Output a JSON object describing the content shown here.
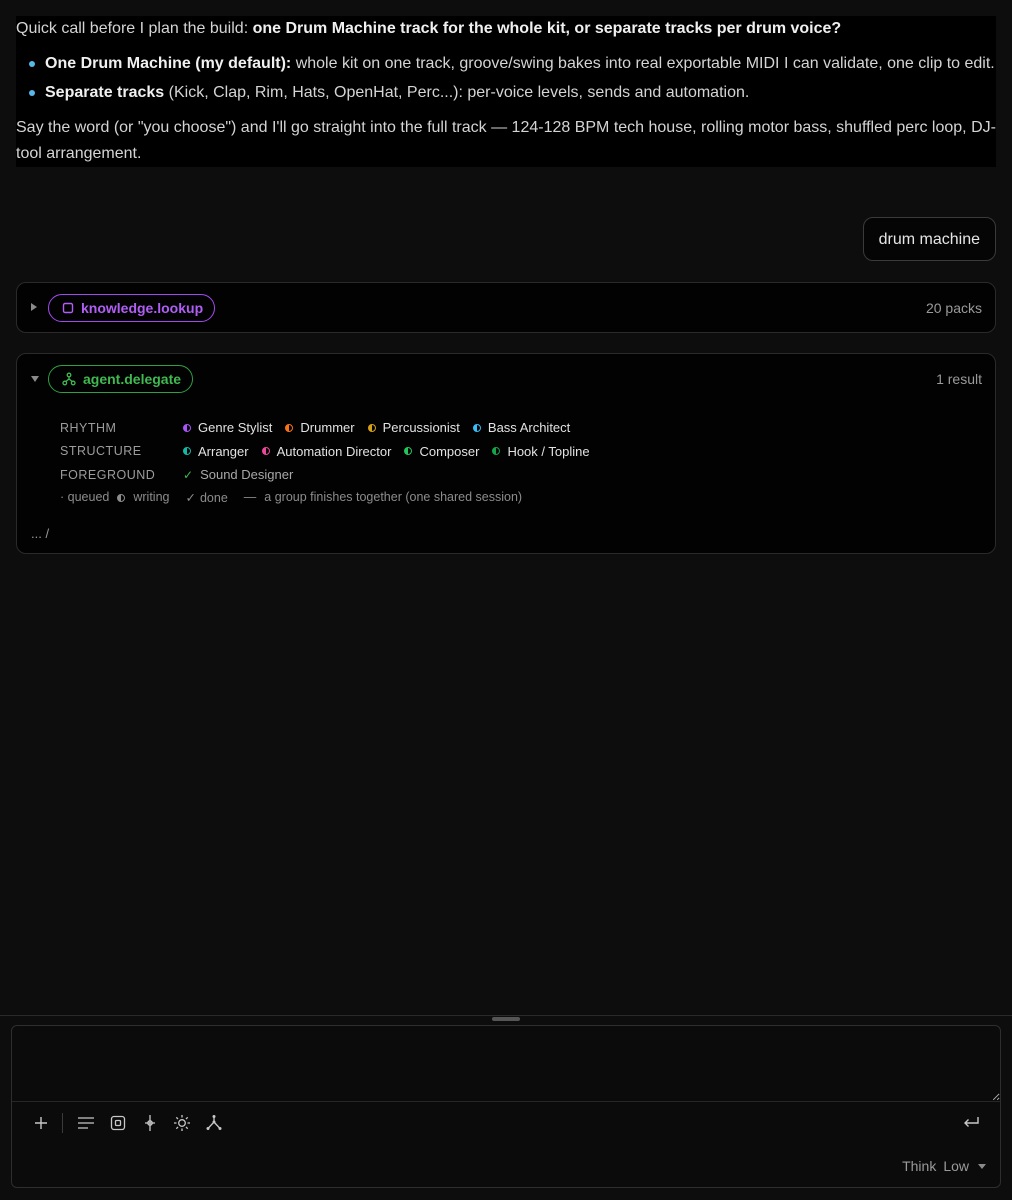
{
  "assistant_message": {
    "intro_prefix": "Quick call before I plan the build: ",
    "intro_bold": "one Drum Machine track for the whole kit, or separate tracks per drum voice?",
    "options": [
      {
        "title": "One Drum Machine (my default):",
        "text": " whole kit on one track, groove/swing bakes into real exportable MIDI I can validate, one clip to edit."
      },
      {
        "title": "Separate tracks",
        "text": " (Kick, Clap, Rim, Hats, OpenHat, Perc...): per-voice levels, sends and automation."
      }
    ],
    "outro": "Say the word (or \"you choose\") and I'll go straight into the full track — 124-128 BPM tech house, rolling motor bass, shuffled perc loop, DJ-tool arrangement."
  },
  "user_message": "drum machine",
  "tool_knowledge": {
    "name": "knowledge.lookup",
    "summary": "20 packs",
    "expanded": false,
    "icon": "square-icon",
    "color": "#a349f2"
  },
  "tool_delegate": {
    "name": "agent.delegate",
    "summary": "1 result",
    "expanded": true,
    "icon": "branch-icon",
    "color": "#2ea043",
    "groups": [
      {
        "label": "RHYTHM",
        "agents": [
          {
            "name": "Genre Stylist",
            "status": "writing",
            "color": "#a855f7"
          },
          {
            "name": "Drummer",
            "status": "writing",
            "color": "#f97316"
          },
          {
            "name": "Percussionist",
            "status": "writing",
            "color": "#d4a017"
          },
          {
            "name": "Bass Architect",
            "status": "writing",
            "color": "#38bdf8"
          }
        ]
      },
      {
        "label": "STRUCTURE",
        "agents": [
          {
            "name": "Arranger",
            "status": "writing",
            "color": "#14b8a6"
          },
          {
            "name": "Automation Director",
            "status": "writing",
            "color": "#ec4899"
          },
          {
            "name": "Composer",
            "status": "writing",
            "color": "#22c55e"
          },
          {
            "name": "Hook / Topline",
            "status": "writing",
            "color": "#16a34a"
          }
        ]
      },
      {
        "label": "FOREGROUND",
        "agents": [
          {
            "name": "Sound Designer",
            "status": "done",
            "color": "#3fb950"
          }
        ]
      }
    ],
    "legend": {
      "queued": "· queued",
      "writing": "writing",
      "done": "done",
      "dash": "—",
      "note": "a group finishes together (one shared session)"
    },
    "footer": "... /"
  },
  "composer": {
    "placeholder": "",
    "think_label": "Think",
    "think_level": "Low"
  }
}
